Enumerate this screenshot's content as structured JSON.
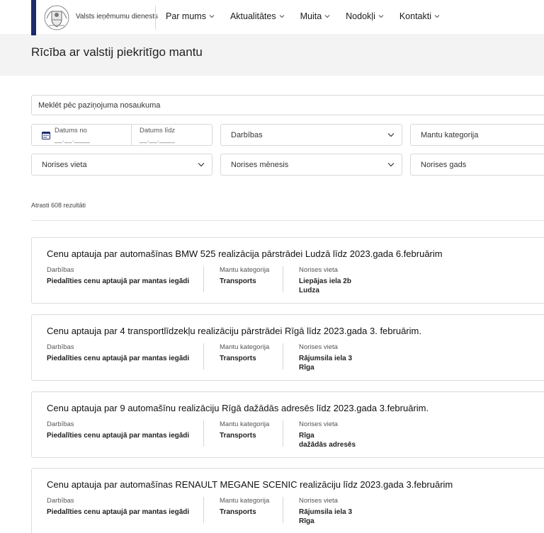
{
  "header": {
    "org_name": "Valsts ieņēmumu dienests",
    "nav": [
      {
        "label": "Par mums"
      },
      {
        "label": "Aktualitātes"
      },
      {
        "label": "Muita"
      },
      {
        "label": "Nodokļi"
      },
      {
        "label": "Kontakti"
      }
    ]
  },
  "page": {
    "title": "Rīcība ar valstij piekritīgo mantu"
  },
  "filters": {
    "search_placeholder": "Meklēt pēc paziņojuma nosaukuma",
    "date_from_label": "Datums no",
    "date_from_value": "__.__.____",
    "date_to_label": "Datums līdz",
    "date_to_value": "__.__.____",
    "darbibas": "Darbības",
    "mantu_kategorija": "Mantu kategorija",
    "norises_vieta": "Norises vieta",
    "norises_menesis": "Norises mēnesis",
    "norises_gads": "Norises gads"
  },
  "results": {
    "count_text": "Atrasti 608 rezultāti"
  },
  "labels": {
    "darbibas": "Darbības",
    "mantu_kategorija": "Mantu kategorija",
    "norises_vieta": "Norises vieta"
  },
  "cards": [
    {
      "title": "Cenu aptauja par automašīnas BMW 525 realizācija pārstrādei Ludzā līdz 2023.gada 6.februārim",
      "darbibas": "Piedalīties cenu aptaujā par mantas iegādi",
      "kategorija": "Transports",
      "vieta_1": "Liepājas iela 2b",
      "vieta_2": "Ludza"
    },
    {
      "title": "Cenu aptauja par 4 transportlīdzekļu realizāciju pārstrādei Rīgā līdz 2023.gada 3. februārim.",
      "darbibas": "Piedalīties cenu aptaujā par mantas iegādi",
      "kategorija": "Transports",
      "vieta_1": "Rājumsila iela 3",
      "vieta_2": "Rīga"
    },
    {
      "title": "Cenu aptauja par 9 automašīnu realizāciju Rīgā dažādās adresēs līdz 2023.gada 3.februārim.",
      "darbibas": "Piedalīties cenu aptaujā par mantas iegādi",
      "kategorija": "Transports",
      "vieta_1": "Rīga",
      "vieta_2": "dažādās adresēs"
    },
    {
      "title": "Cenu aptauja par automašīnas RENAULT MEGANE SCENIC realizāciju līdz 2023.gada 3.februārim",
      "darbibas": "Piedalīties cenu aptaujā par mantas iegādi",
      "kategorija": "Transports",
      "vieta_1": "Rājumsila iela 3",
      "vieta_2": "Rīga"
    }
  ],
  "colors": {
    "accent": "#1c2a6e",
    "title_band": "#f3f3f3"
  },
  "icons": [
    "coat-of-arms-logo",
    "chevron-down-icon",
    "calendar-icon"
  ]
}
